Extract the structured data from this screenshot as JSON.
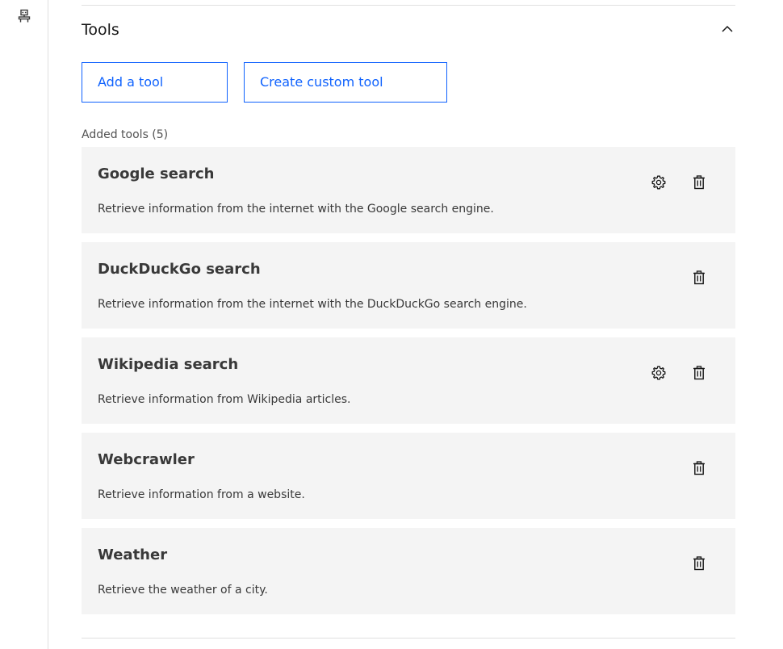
{
  "section": {
    "title": "Tools",
    "collapse_icon": "chevron-up-icon"
  },
  "actions": {
    "add_tool_label": "Add a tool",
    "create_custom_tool_label": "Create custom tool"
  },
  "added_tools": {
    "label": "Added tools (5)",
    "items": [
      {
        "name": "Google search",
        "description": "Retrieve information from the internet with the Google search engine.",
        "has_settings": true
      },
      {
        "name": "DuckDuckGo search",
        "description": "Retrieve information from the internet with the DuckDuckGo search engine.",
        "has_settings": false
      },
      {
        "name": "Wikipedia search",
        "description": "Retrieve information from Wikipedia articles.",
        "has_settings": true
      },
      {
        "name": "Webcrawler",
        "description": "Retrieve information from a website.",
        "has_settings": false
      },
      {
        "name": "Weather",
        "description": "Retrieve the weather of a city.",
        "has_settings": false
      }
    ]
  },
  "colors": {
    "accent": "#0f62fe",
    "card_background": "#f4f4f4",
    "text": "#161616",
    "secondary_text": "#525252"
  }
}
